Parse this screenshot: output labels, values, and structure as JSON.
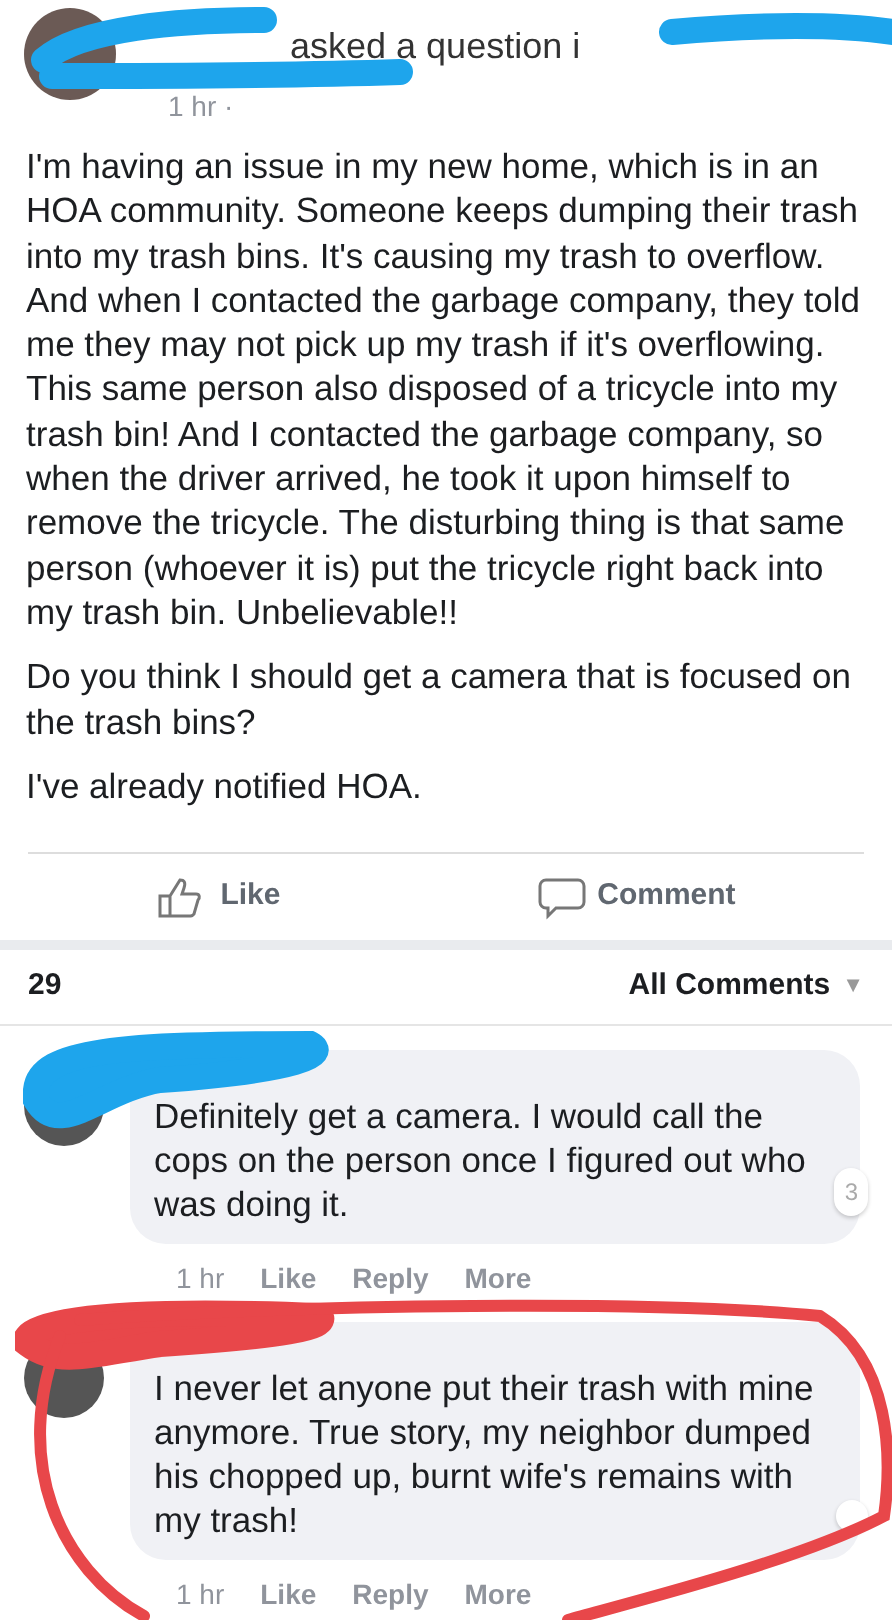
{
  "post": {
    "header": "asked a question i",
    "time": "1 hr ·",
    "paragraphs": [
      "I'm having an issue in my new home, which is in an HOA community. Someone keeps dumping their trash into my trash bins. It's causing my trash to overflow. And when I contacted the garbage company, they told me they may not pick up my trash if it's overflowing. This same person also disposed of a tricycle into my trash bin! And I contacted the garbage company, so when the driver arrived, he took it upon himself to remove the tricycle. The disturbing thing is that same person (whoever it is) put the tricycle right back into my trash bin. Unbelievable!!",
      "Do you think I should get a camera that is focused on the trash bins?",
      "I've already notified HOA."
    ]
  },
  "actions": [
    {
      "kind": "like",
      "label": "Like"
    },
    {
      "kind": "comment",
      "label": "Comment"
    }
  ],
  "comment_count": "29",
  "sort": "All Comments",
  "sort_caret": "▼",
  "comments": [
    {
      "text": "Definitely get a camera. I would call the cops on the person once I figured out who was doing it.",
      "reactions": "3",
      "time": "1 hr",
      "links": [
        "Like",
        "Reply",
        "More"
      ]
    },
    {
      "text": "I never let anyone put their trash with mine anymore. True story, my neighbor dumped his chopped up, burnt wife's remains with my trash!",
      "time": "1 hr",
      "links": [
        "Like",
        "Reply",
        "More"
      ]
    }
  ],
  "markup": [
    {
      "kind": "scribble",
      "color": "#1ea5ec"
    },
    {
      "kind": "scribble",
      "color": "#1ea5ec"
    },
    {
      "kind": "scribble",
      "color": "#1ea5ec"
    },
    {
      "kind": "scribble",
      "color": "#e8474a"
    },
    {
      "kind": "circle",
      "color": "#e8474a"
    }
  ]
}
